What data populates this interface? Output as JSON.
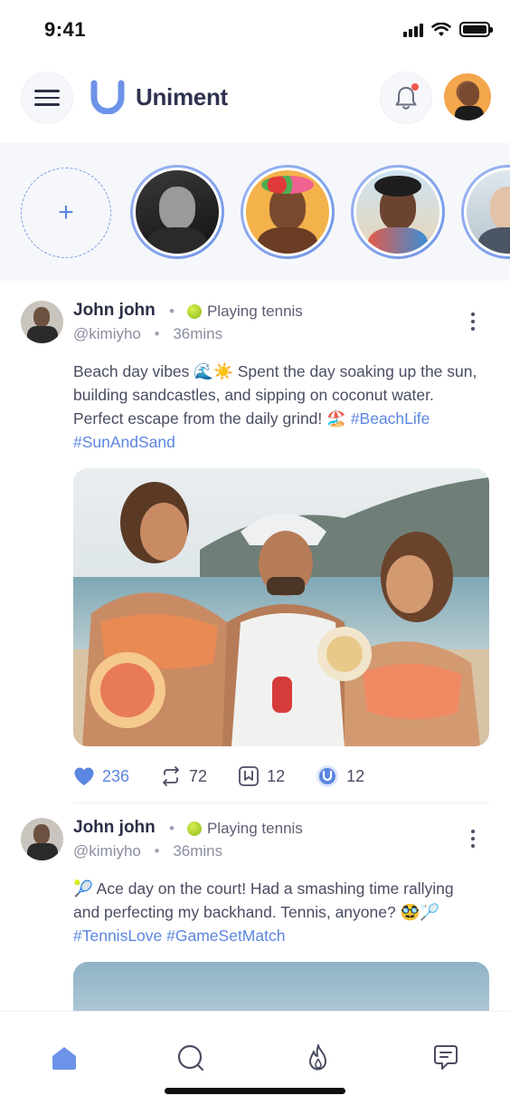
{
  "status_bar": {
    "time": "9:41"
  },
  "header": {
    "app_name": "Uniment"
  },
  "colors": {
    "accent": "#5b86e0",
    "text": "#2b2e45",
    "notification_dot": "#f2584c",
    "story_bg": "#f5f7fa"
  },
  "stories": {
    "add_label": "+",
    "items": [
      {
        "name": "story-1"
      },
      {
        "name": "story-2"
      },
      {
        "name": "story-3"
      },
      {
        "name": "story-4"
      }
    ]
  },
  "posts": [
    {
      "name": "John john",
      "activity": "Playing tennis",
      "handle": "@kimiyho",
      "time": "36mins",
      "text_lines": [
        "Beach day vibes 🌊☀️ Spent the day soaking up the sun,",
        "building sandcastles, and sipping on coconut water.",
        "Perfect escape from the daily grind! 🏖️"
      ],
      "hashtags": [
        "#BeachLife",
        "#SunAndSand"
      ],
      "likes": "236",
      "reposts": "72",
      "saves": "12",
      "uniments": "12"
    },
    {
      "name": "John john",
      "activity": "Playing tennis",
      "handle": "@kimiyho",
      "time": "36mins",
      "text_lines": [
        "🎾 Ace day on the court! Had a smashing time rallying",
        "and perfecting my backhand. Tennis, anyone? 🥸🏸"
      ],
      "hashtags": [
        "#TennisLove",
        "#GameSetMatch"
      ]
    }
  ],
  "icons": {
    "menu": "hamburger-icon",
    "bell": "bell-icon",
    "like": "heart-icon",
    "repost": "repost-icon",
    "save": "bookmark-icon",
    "uniment": "uniment-icon",
    "nav_home": "home-icon",
    "nav_search": "search-icon",
    "nav_trending": "flame-icon",
    "nav_messages": "chat-icon"
  }
}
